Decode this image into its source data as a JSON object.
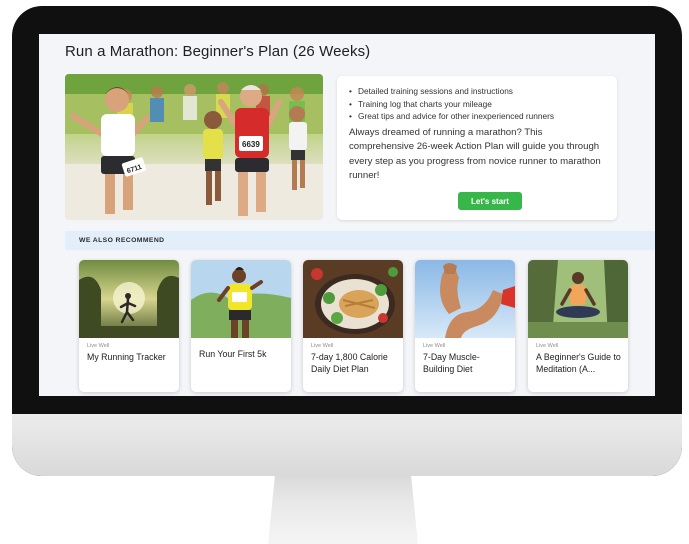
{
  "page": {
    "title": "Run a Marathon: Beginner's Plan (26 Weeks)"
  },
  "hero": {
    "image_alt": "Marathon runners racing",
    "bib_left": "6711",
    "bib_right": "6639"
  },
  "info": {
    "bullets": [
      "Detailed training sessions and instructions",
      "Training log that charts your mileage",
      "Great tips and advice for other inexperienced runners"
    ],
    "description": "Always dreamed of running a marathon? This comprehensive 26-week Action Plan will guide you through every step as you progress from novice runner to marathon runner!",
    "cta_label": "Let's start",
    "cta_color": "#37b64a"
  },
  "recommend": {
    "heading": "WE ALSO RECOMMEND",
    "cards": [
      {
        "category": "Live Well",
        "title": "My Running Tracker"
      },
      {
        "category": "",
        "title": "Run Your First 5k"
      },
      {
        "category": "Live Well",
        "title": "7-day 1,800 Calorie Daily Diet Plan"
      },
      {
        "category": "Live Well",
        "title": "7-Day Muscle-Building Diet"
      },
      {
        "category": "Live Well",
        "title": "A Beginner's Guide to Meditation (A..."
      }
    ]
  },
  "colors": {
    "accent_bar": "#e3eefb",
    "monitor_bezel": "#101010"
  }
}
